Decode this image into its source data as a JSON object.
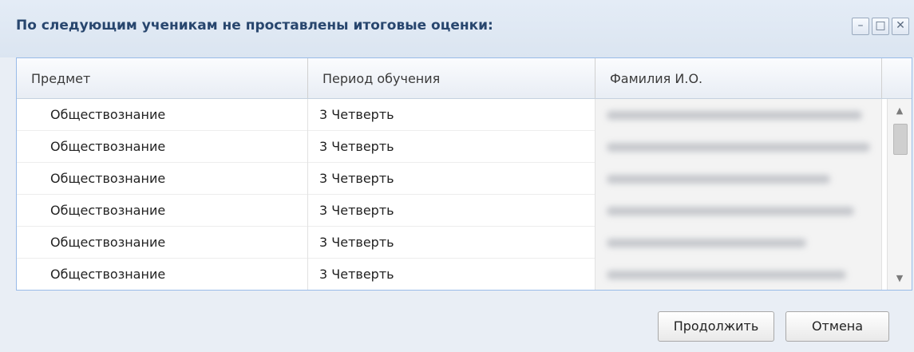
{
  "dialog": {
    "title": "По следующим ученикам не проставлены итоговые оценки:",
    "controls": {
      "minimize": "–",
      "maximize": "□",
      "close": "✕"
    }
  },
  "grid": {
    "columns": [
      "Предмет",
      "Период обучения",
      "Фамилия И.О."
    ],
    "rows": [
      {
        "subject": "Обществознание",
        "period": "3 Четверть"
      },
      {
        "subject": "Обществознание",
        "period": "3 Четверть"
      },
      {
        "subject": "Обществознание",
        "period": "3 Четверть"
      },
      {
        "subject": "Обществознание",
        "period": "3 Четверть"
      },
      {
        "subject": "Обществознание",
        "period": "3 Четверть"
      },
      {
        "subject": "Обществознание",
        "period": "3 Четверть"
      }
    ]
  },
  "buttons": {
    "continue": "Продолжить",
    "cancel": "Отмена"
  },
  "colors": {
    "header_text": "#28466e",
    "grid_border": "#99bbe8",
    "window_bg": "#e9eef5"
  },
  "icons": {
    "scroll_up": "▲",
    "scroll_down": "▼"
  }
}
